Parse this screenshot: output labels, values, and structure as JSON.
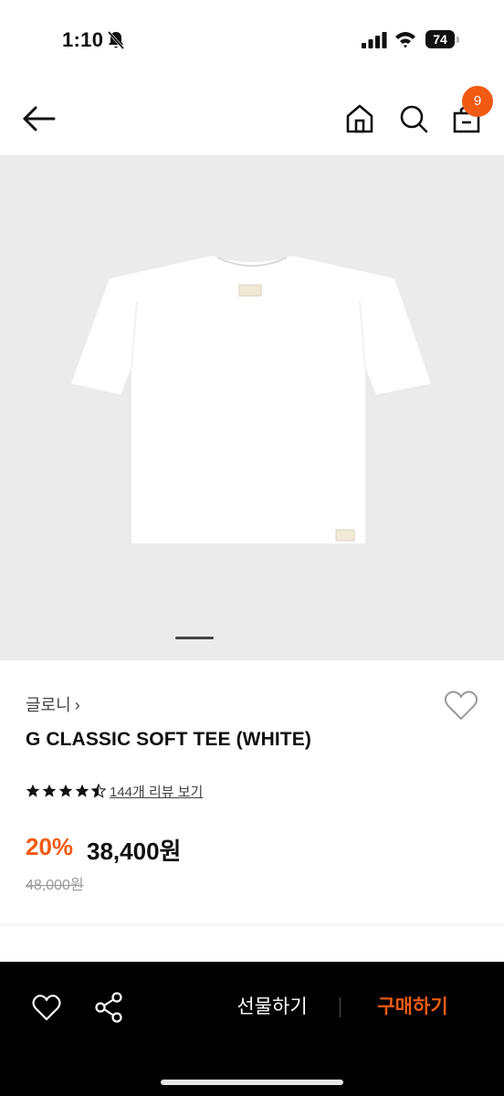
{
  "status_bar": {
    "time": "1:10",
    "battery": "74"
  },
  "nav": {
    "cart_count": "9"
  },
  "product": {
    "brand": "글로니",
    "brand_chevron": "›",
    "title": "G CLASSIC SOFT TEE (WHITE)",
    "rating": 4.5,
    "review_link": "144개 리뷰 보기",
    "discount": "20%",
    "sale_price": "38,400원",
    "original_price": "48,000원"
  },
  "gallery": {
    "current_index": 1
  },
  "bottom_bar": {
    "gift_label": "선물하기",
    "buy_label": "구매하기"
  },
  "colors": {
    "accent": "#f05a13",
    "image_bg": "#ebebeb",
    "bottom_bar_bg": "#000000"
  },
  "icons": [
    "bell-muted-icon",
    "signal-icon",
    "wifi-icon",
    "battery-icon",
    "back-arrow-icon",
    "home-icon",
    "search-icon",
    "bag-icon",
    "heart-outline-icon",
    "star-icon",
    "share-icon"
  ]
}
